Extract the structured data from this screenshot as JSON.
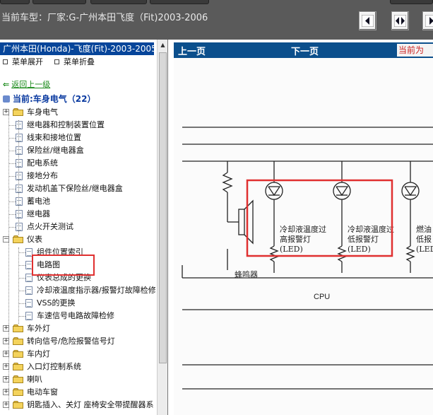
{
  "header": {
    "car_model": "当前车型：厂家:G-广州本田飞度（Fit)2003-2006",
    "nav_buttons": [
      "first-page-icon",
      "prev-next-icon",
      "last-page-icon"
    ]
  },
  "sidebar": {
    "title": "广州本田(Honda)-飞度(Fit)-2003-2005",
    "expand_label": "菜单展开",
    "collapse_label": "菜单折叠",
    "back_label": "返回上一级",
    "current_label": "当前:车身电气（22）",
    "tree": [
      {
        "label": "车身电气",
        "type": "folder",
        "level": 0
      },
      {
        "label": "继电器和控制装置位置",
        "type": "doc",
        "level": 1
      },
      {
        "label": "线束和接地位置",
        "type": "doc",
        "level": 1
      },
      {
        "label": "保险丝/继电器盒",
        "type": "doc",
        "level": 1
      },
      {
        "label": "配电系统",
        "type": "doc",
        "level": 1
      },
      {
        "label": "接地分布",
        "type": "doc",
        "level": 1
      },
      {
        "label": "发动机盖下保险丝/继电器盒",
        "type": "doc",
        "level": 1
      },
      {
        "label": "蓄电池",
        "type": "doc",
        "level": 1
      },
      {
        "label": "继电器",
        "type": "doc",
        "level": 1
      },
      {
        "label": "点火开关测试",
        "type": "doc",
        "level": 1
      },
      {
        "label": "仪表",
        "type": "folder-open",
        "level": 0
      },
      {
        "label": "组件位置索引",
        "type": "doc",
        "level": 2
      },
      {
        "label": "电路图",
        "type": "doc",
        "level": 2
      },
      {
        "label": "仪表总成的更换",
        "type": "doc",
        "level": 2
      },
      {
        "label": "冷却液温度指示器/报警灯故障检修",
        "type": "doc",
        "level": 2
      },
      {
        "label": "VSS的更换",
        "type": "doc",
        "level": 2
      },
      {
        "label": "车速信号电路故障检修",
        "type": "doc",
        "level": 2
      },
      {
        "label": "车外灯",
        "type": "folder",
        "level": 0
      },
      {
        "label": "转向信号/危险报警信号灯",
        "type": "folder",
        "level": 0
      },
      {
        "label": "车内灯",
        "type": "folder",
        "level": 0
      },
      {
        "label": "入口灯控制系统",
        "type": "folder",
        "level": 0
      },
      {
        "label": "喇叭",
        "type": "folder",
        "level": 0
      },
      {
        "label": "电动车窗",
        "type": "folder",
        "level": 0
      },
      {
        "label": "钥匙插入、关灯 座椅安全带提醒器系",
        "type": "folder",
        "level": 0
      }
    ]
  },
  "main": {
    "prev_label": "上一页",
    "next_label": "下一页",
    "current_label": "当前为",
    "diagram": {
      "led_label_1": "冷却液温度过",
      "led_label_1b": "高报警灯",
      "led_label_1c": "(LED)",
      "led_label_2": "冷却液温度过",
      "led_label_2b": "低报警灯",
      "led_label_2c": "(LED)",
      "led_label_3": "燃油",
      "led_label_3b": "低报",
      "led_label_3c": "(LED",
      "buzzer_label": "蜂鸣器",
      "cpu_label": "CPU"
    }
  },
  "colors": {
    "accent_blue": "#06459a",
    "nav_blue": "#0b4f8c",
    "highlight_red": "#e03030"
  }
}
